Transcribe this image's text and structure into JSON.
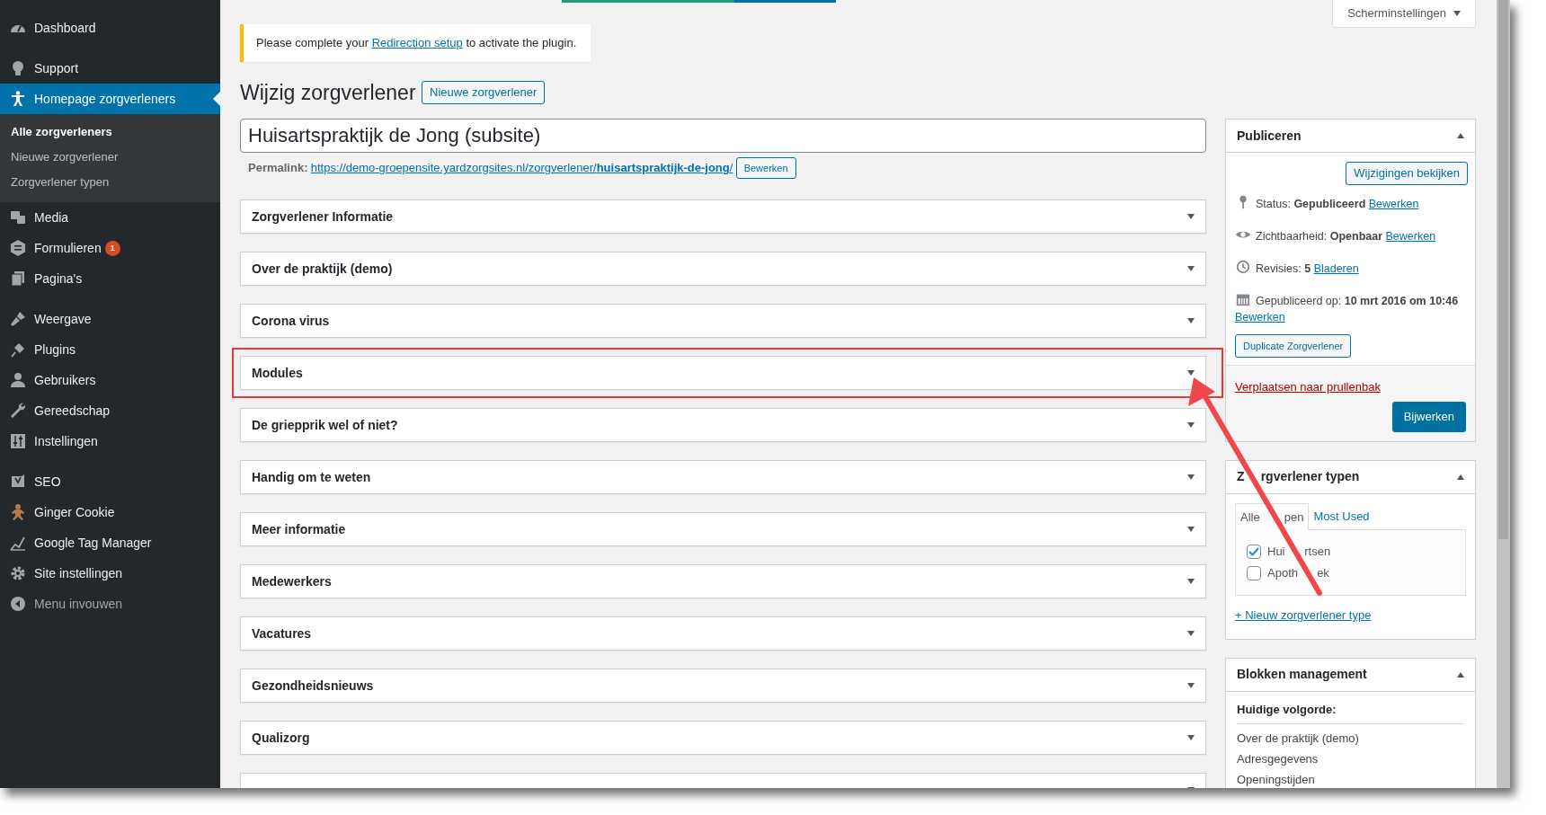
{
  "sidebar": {
    "groups": [
      [
        {
          "label": "Dashboard",
          "selected": false
        }
      ],
      [
        {
          "label": "Support",
          "selected": false
        },
        {
          "label": "Homepage zorgverleners",
          "selected": true,
          "children": [
            {
              "label": "Alle zorgverleners",
              "selected": true
            },
            {
              "label": "Nieuwe zorgverlener",
              "selected": false
            },
            {
              "label": "Zorgverlener typen",
              "selected": false
            }
          ]
        },
        {
          "label": "Media",
          "selected": false
        },
        {
          "label": "Formulieren",
          "selected": false,
          "badge": "1"
        },
        {
          "label": "Pagina's",
          "selected": false
        }
      ],
      [
        {
          "label": "Weergave",
          "selected": false
        },
        {
          "label": "Plugins",
          "selected": false
        },
        {
          "label": "Gebruikers",
          "selected": false
        },
        {
          "label": "Gereedschap",
          "selected": false
        },
        {
          "label": "Instellingen",
          "selected": false
        }
      ],
      [
        {
          "label": "SEO",
          "selected": false
        },
        {
          "label": "Ginger Cookie",
          "selected": false
        },
        {
          "label": "Google Tag Manager",
          "selected": false
        },
        {
          "label": "Site instellingen",
          "selected": false
        },
        {
          "label": "Menu invouwen",
          "selected": false
        }
      ]
    ]
  },
  "screen_options": "Scherminstellingen",
  "notice": {
    "before": "Please complete your ",
    "link": "Redirection setup",
    "after": " to activate the plugin."
  },
  "heading": "Wijzig zorgverlener",
  "new_button": "Nieuwe zorgverlener",
  "title_value": "Huisartspraktijk de Jong (subsite)",
  "permalink": {
    "label": "Permalink:",
    "url": "https://demo-groepensite.yardzorgsites.nl/zorgverlener/**huisartspraktijk-de-jong**/",
    "button": "Bewerken"
  },
  "metaboxes": [
    {
      "title": "Zorgverlener Informatie",
      "highlighted": false
    },
    {
      "title": "Over de praktijk (demo)",
      "highlighted": false
    },
    {
      "title": "Corona virus",
      "highlighted": false
    },
    {
      "title": "Modules",
      "highlighted": true
    },
    {
      "title": "De griepprik wel of niet?",
      "highlighted": false
    },
    {
      "title": "Handig om te weten",
      "highlighted": false
    },
    {
      "title": "Meer informatie",
      "highlighted": false
    },
    {
      "title": "Medewerkers",
      "highlighted": false
    },
    {
      "title": "Vacatures",
      "highlighted": false
    },
    {
      "title": "Gezondheidsnieuws",
      "highlighted": false
    },
    {
      "title": "Qualizorg",
      "highlighted": false
    },
    {
      "highlighted": false
    }
  ],
  "publish": {
    "title": "Publiceren",
    "preview_button": "Wijzigingen bekijken",
    "rows": [
      {
        "text": "Status: **Gepubliceerd**",
        "link": "Bewerken"
      },
      {
        "text": "Zichtbaarheid: **Openbaar**",
        "link": "Bewerken"
      },
      {
        "text": "Revisies: **5**",
        "link": "Bladeren"
      },
      {
        "text": "Gepubliceerd op: **10 mrt 2016 om 10:46**",
        "link": "Bewerken"
      }
    ],
    "duplicate_button": "Duplicate Zorgverlener",
    "trash_link": "Verplaatsen naar prullenbak",
    "update_button": "Bijwerken"
  },
  "types": {
    "title": [
      "Z",
      "rgverlener typen"
    ],
    "tabs": [
      {
        "label": [
          "Alle",
          "pen"
        ],
        "selected": true
      },
      {
        "label": [
          "Most Used"
        ],
        "selected": false
      }
    ],
    "options": [
      {
        "label": [
          "Hui",
          "rtsen"
        ],
        "checked": true
      },
      {
        "label": [
          "Apoth",
          "ek"
        ],
        "checked": false
      }
    ],
    "add_link": "+ Nieuw zorgverlener type"
  },
  "blocks": {
    "title": "Blokken management",
    "subtitle": "Huidige volgorde:",
    "items": [
      "Over de praktijk (demo)",
      "Adresgegevens",
      "Openingstijden"
    ]
  }
}
